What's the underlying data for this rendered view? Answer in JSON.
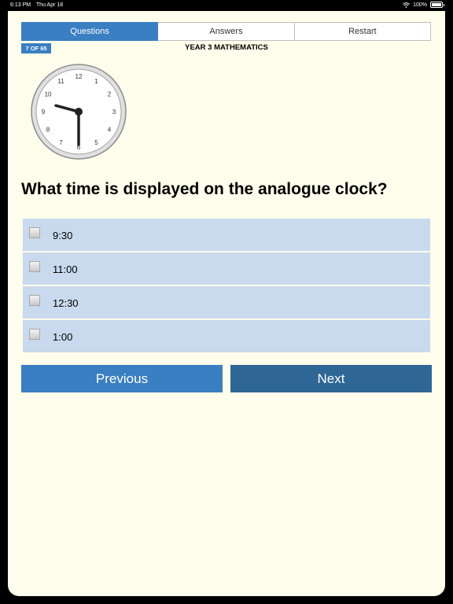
{
  "status_bar": {
    "time": "6:13 PM",
    "date": "Thu Apr 18",
    "battery": "100%",
    "battery_level": 1.0
  },
  "tabs": [
    {
      "label": "Questions",
      "active": true
    },
    {
      "label": "Answers",
      "active": false
    },
    {
      "label": "Restart",
      "active": false
    }
  ],
  "progress": {
    "label": "7 OF 65",
    "current": 7,
    "total": 65
  },
  "quiz_title": "YEAR 3 MATHEMATICS",
  "clock": {
    "numbers": [
      "12",
      "1",
      "2",
      "3",
      "4",
      "5",
      "6",
      "7",
      "8",
      "9",
      "10",
      "11"
    ],
    "hour": 9,
    "minute": 30
  },
  "question": "What time is displayed on the analogue clock?",
  "options": [
    {
      "label": "9:30",
      "checked": false
    },
    {
      "label": "11:00",
      "checked": false
    },
    {
      "label": "12:30",
      "checked": false
    },
    {
      "label": "1:00",
      "checked": false
    }
  ],
  "buttons": {
    "previous": "Previous",
    "next": "Next"
  },
  "colors": {
    "background": "#fffeec",
    "accent": "#3a7fc1",
    "next_button": "#2e6695",
    "option_bg": "#c9d9ee"
  }
}
